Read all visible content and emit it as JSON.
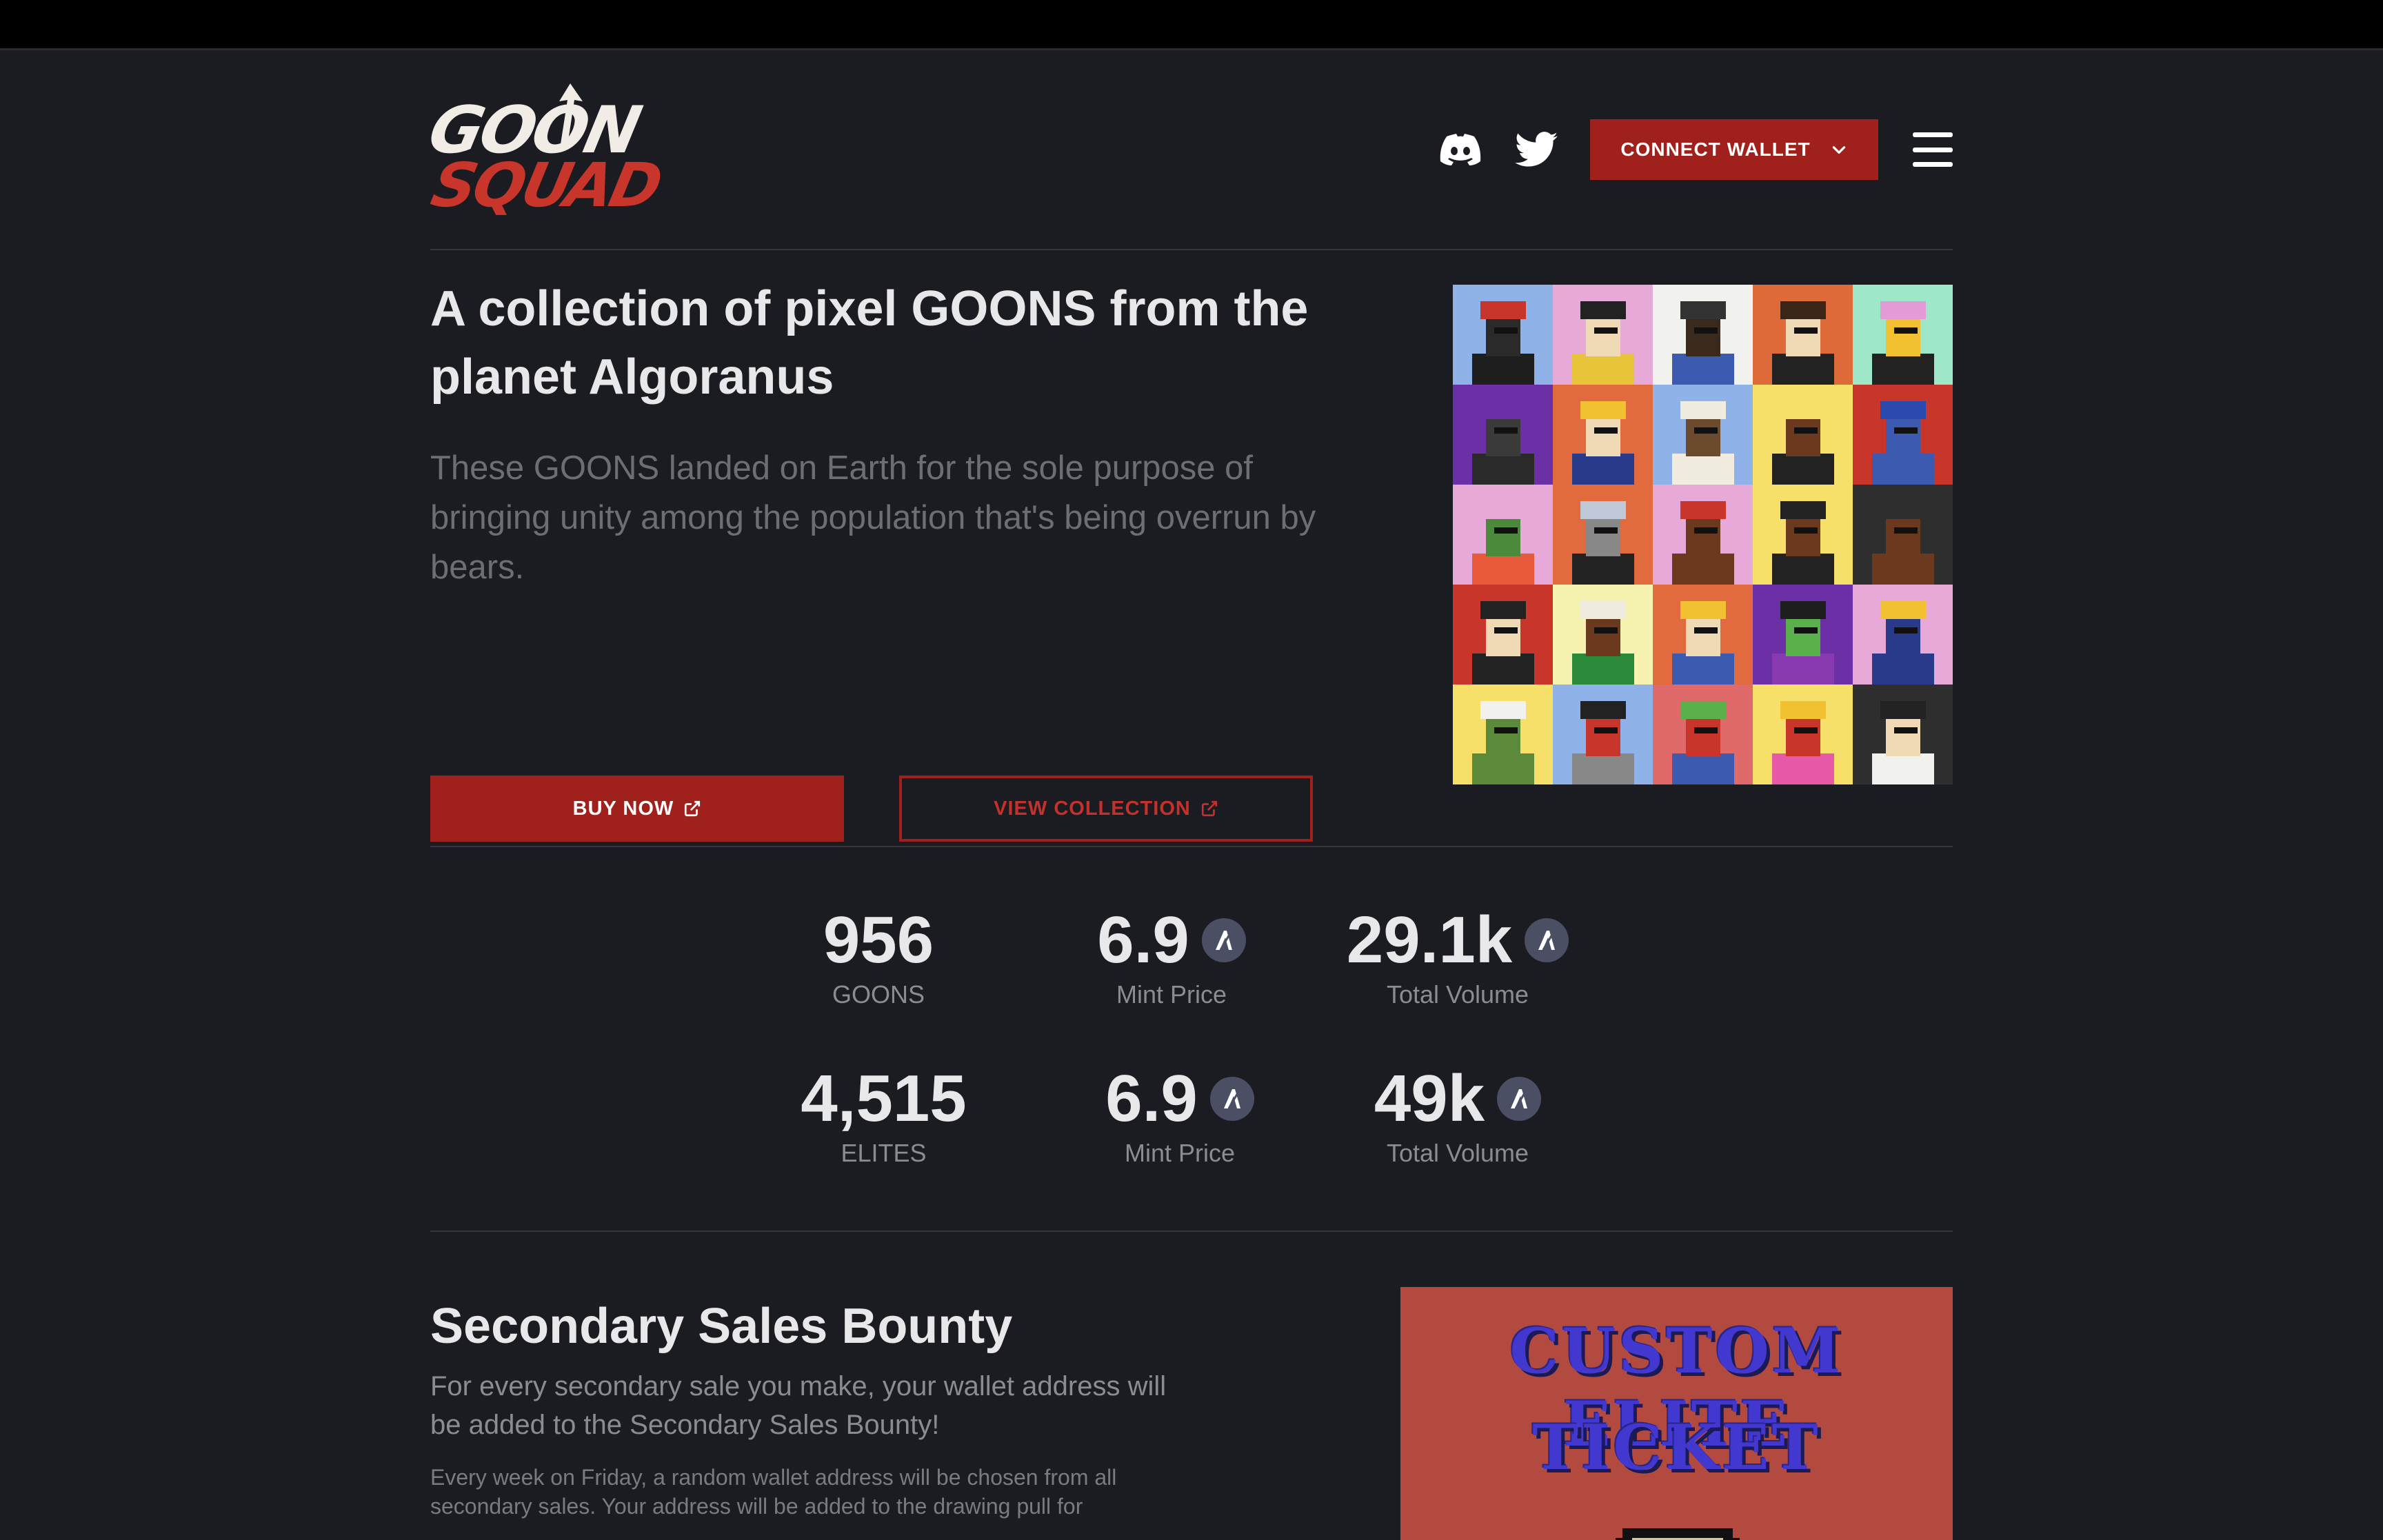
{
  "logo": {
    "line1": "GOON",
    "line2": "SQUAD"
  },
  "header": {
    "connect_label": "CONNECT WALLET"
  },
  "hero": {
    "title": "A collection of pixel GOONS from the planet Algoranus",
    "description": "These GOONS landed on Earth for the sole purpose of bringing unity among the population that's being overrun by bears.",
    "buy_label": "BUY NOW",
    "view_label": "VIEW COLLECTION"
  },
  "stats": {
    "goons_count": "956",
    "goons_label": "GOONS",
    "goons_mint": "6.9",
    "goons_mint_label": "Mint Price",
    "goons_volume": "29.1k",
    "goons_volume_label": "Total Volume",
    "elites_count": "4,515",
    "elites_label": "ELITES",
    "elites_mint": "6.9",
    "elites_mint_label": "Mint Price",
    "elites_volume": "49k",
    "elites_volume_label": "Total Volume"
  },
  "bounty": {
    "title": "Secondary Sales Bounty",
    "description": "For every secondary sale you make, your wallet address will be added to the Secondary Sales Bounty!",
    "more": "Every week on Friday, a random wallet address will be chosen from all secondary sales. Your address will be added to the drawing pull for",
    "ticket_line1": "CUSTOM ELITE",
    "ticket_line2": "TICKET"
  },
  "colors": {
    "accent": "#a0211c",
    "background": "#1b1c21",
    "algo_badge": "#4a4f63"
  },
  "goons": [
    {
      "bg": "#8fb3e8",
      "skin": "#2a2a2a",
      "hat": "#c8352b",
      "shirt": "#1e1e1e"
    },
    {
      "bg": "#e7a9d8",
      "skin": "#f0d9b5",
      "hat": "#222222",
      "shirt": "#e8c43a"
    },
    {
      "bg": "#f1f1ee",
      "skin": "#3a2a1e",
      "hat": "#333333",
      "shirt": "#3b5ab0"
    },
    {
      "bg": "#de6a3a",
      "skin": "#f0d9b5",
      "hat": "#3b2418",
      "shirt": "#222222"
    },
    {
      "bg": "#9fe7c9",
      "skin": "#f1c132",
      "hat": "#e59ad8",
      "shirt": "#222222"
    },
    {
      "bg": "#6b2fa6",
      "skin": "#3a3a3a",
      "hat": "#6b2fa6",
      "shirt": "#2a2a2a"
    },
    {
      "bg": "#e16b3e",
      "skin": "#f0d9b5",
      "hat": "#f1c132",
      "shirt": "#2a3a8a"
    },
    {
      "bg": "#8fb3e8",
      "skin": "#6b4a2e",
      "hat": "#f1ece0",
      "shirt": "#f1ece0"
    },
    {
      "bg": "#f6e06a",
      "skin": "#6b3a1e",
      "hat": "#f6e06a",
      "shirt": "#222222"
    },
    {
      "bg": "#c8352b",
      "skin": "#3b5ab0",
      "hat": "#2a4ab0",
      "shirt": "#3b5ab0"
    },
    {
      "bg": "#e7a9d8",
      "skin": "#4a8a3a",
      "hat": "#e7a9d8",
      "shirt": "#e85a3a"
    },
    {
      "bg": "#e16b3e",
      "skin": "#888888",
      "hat": "#bfc9d8",
      "shirt": "#222222"
    },
    {
      "bg": "#e7a9d8",
      "skin": "#6b3a1e",
      "hat": "#c8352b",
      "shirt": "#6b3a1e"
    },
    {
      "bg": "#f6e06a",
      "skin": "#6b3a1e",
      "hat": "#222222",
      "shirt": "#222222"
    },
    {
      "bg": "#2e2e2e",
      "skin": "#6b3a1e",
      "hat": "#2e2e2e",
      "shirt": "#6b3a1e"
    },
    {
      "bg": "#c8352b",
      "skin": "#f0d9b5",
      "hat": "#222222",
      "shirt": "#222222"
    },
    {
      "bg": "#f6f2b0",
      "skin": "#6b3a1e",
      "hat": "#f1ece0",
      "shirt": "#2a8a3a"
    },
    {
      "bg": "#e16b3e",
      "skin": "#f0d9b5",
      "hat": "#f1c132",
      "shirt": "#3b5ab0"
    },
    {
      "bg": "#6b2fa6",
      "skin": "#5ab04a",
      "hat": "#1e1e1e",
      "shirt": "#8a3ab0"
    },
    {
      "bg": "#e7a9d8",
      "skin": "#2a3a8a",
      "hat": "#f1c132",
      "shirt": "#2a3a8a"
    },
    {
      "bg": "#f6e06a",
      "skin": "#5a8a3a",
      "hat": "#f1f1ee",
      "shirt": "#5a8a3a"
    },
    {
      "bg": "#8fb3e8",
      "skin": "#c8352b",
      "hat": "#222222",
      "shirt": "#888888"
    },
    {
      "bg": "#e06a6a",
      "skin": "#c8352b",
      "hat": "#5ab04a",
      "shirt": "#3b5ab0"
    },
    {
      "bg": "#f6e06a",
      "skin": "#c8352b",
      "hat": "#f1c132",
      "shirt": "#e85aa8"
    },
    {
      "bg": "#2e2e2e",
      "skin": "#f0d9b5",
      "hat": "#222222",
      "shirt": "#f1f1ee"
    }
  ]
}
